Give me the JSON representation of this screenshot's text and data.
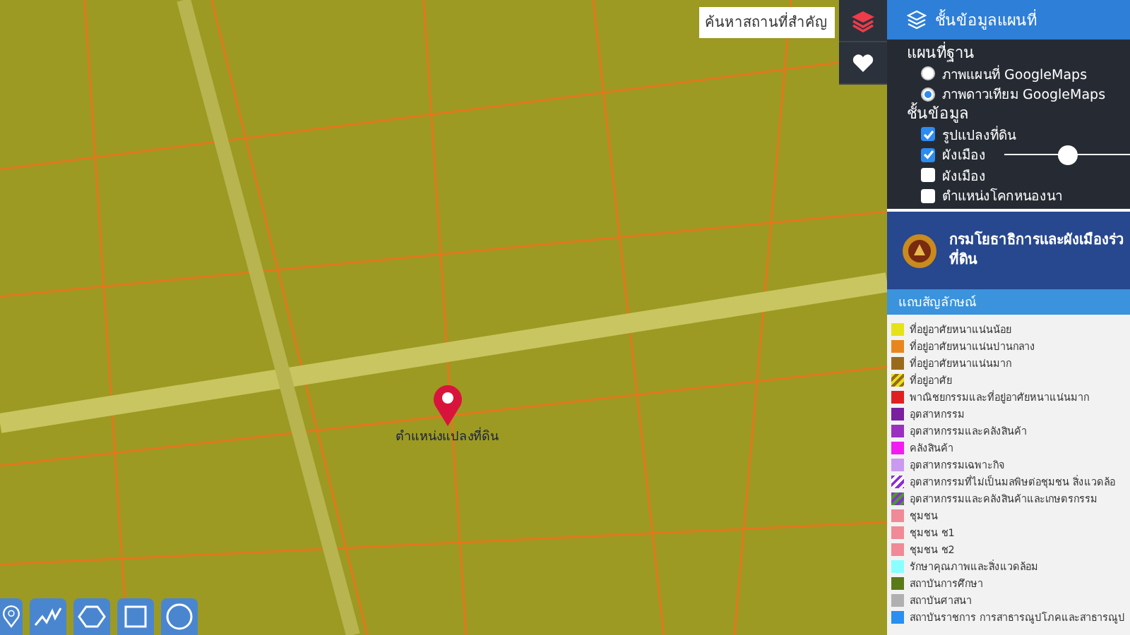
{
  "search": {
    "placeholder": "ค้นหาสถานที่สำคัญ"
  },
  "map": {
    "marker_label": "ตำแหน่งแปลงที่ดิน"
  },
  "map_tools": [
    {
      "kind": "pin"
    },
    {
      "kind": "line"
    },
    {
      "kind": "polygon"
    },
    {
      "kind": "rectangle"
    },
    {
      "kind": "circle"
    }
  ],
  "panel": {
    "title": "ชั้นข้อมูลแผนที่",
    "basemap": {
      "heading": "แผนที่ฐาน",
      "options": [
        {
          "label": "ภาพแผนที่ GoogleMaps",
          "selected": false
        },
        {
          "label": "ภาพดาวเทียม GoogleMaps",
          "selected": true
        }
      ]
    },
    "layers": {
      "heading": "ชั้นข้อมูล",
      "items": [
        {
          "label": "รูปแปลงที่ดิน",
          "checked": true
        },
        {
          "label": "ผังเมือง",
          "checked": true,
          "level": 0.5
        },
        {
          "label": "ผังเมือง",
          "checked": false
        },
        {
          "label": "ตำแหน่งโคกหนองนา",
          "checked": false
        }
      ]
    },
    "agency": {
      "lines": [
        "กรมโยธาธิการและผังเมืองร่ว",
        "ที่ดิน"
      ]
    },
    "legend": {
      "title": "แถบสัญลักษณ์",
      "items": [
        {
          "label": "ที่อยู่อาศัยหนาแน่นน้อย",
          "color": "#e6e21a"
        },
        {
          "label": "ที่อยู่อาศัยหนาแน่นปานกลาง",
          "color": "#e8861e"
        },
        {
          "label": "ที่อยู่อาศัยหนาแน่นมาก",
          "color": "#9a6a1c"
        },
        {
          "label": "ที่อยู่อาศัย",
          "color": "#e6e21a",
          "stripe": {
            "color": "#9a6a1c"
          }
        },
        {
          "label": "พาณิชยกรรมและที่อยู่อาศัยหนาแน่นมาก",
          "color": "#e02020"
        },
        {
          "label": "อุตสาหกรรม",
          "color": "#7a1fa0"
        },
        {
          "label": "อุตสาหกรรมและคลังสินค้า",
          "color": "#9b2fc0"
        },
        {
          "label": "คลังสินค้า",
          "color": "#f21cf2"
        },
        {
          "label": "อุตสาหกรรมเฉพาะกิจ",
          "color": "#c99af0"
        },
        {
          "label": "อุตสาหกรรมที่ไม่เป็นมลพิษต่อชุมชน สิ่งแวดล้อ",
          "color": "#8a2fd0",
          "stripe": {
            "color": "#ffffff"
          }
        },
        {
          "label": "อุตสาหกรรมและคลังสินค้าและเกษตรกรรม",
          "color": "#8a2fd0",
          "stripe": {
            "color": "#4a9a2a"
          }
        },
        {
          "label": "ชุมชน",
          "color": "#f08a96"
        },
        {
          "label": "ชุมชน ช1",
          "color": "#f08a96"
        },
        {
          "label": "ชุมชน ช2",
          "color": "#f08a96"
        },
        {
          "label": "รักษาคุณภาพและสิ่งแวดล้อม",
          "color": "#8affff"
        },
        {
          "label": "สถาบันการศึกษา",
          "color": "#5a7a1a"
        },
        {
          "label": "สถาบันศาสนา",
          "color": "#b0b0b0"
        },
        {
          "label": "สถาบันราชการ การสาธารณูปโภคและสาธารณูป",
          "color": "#2a8ff0"
        }
      ]
    }
  }
}
